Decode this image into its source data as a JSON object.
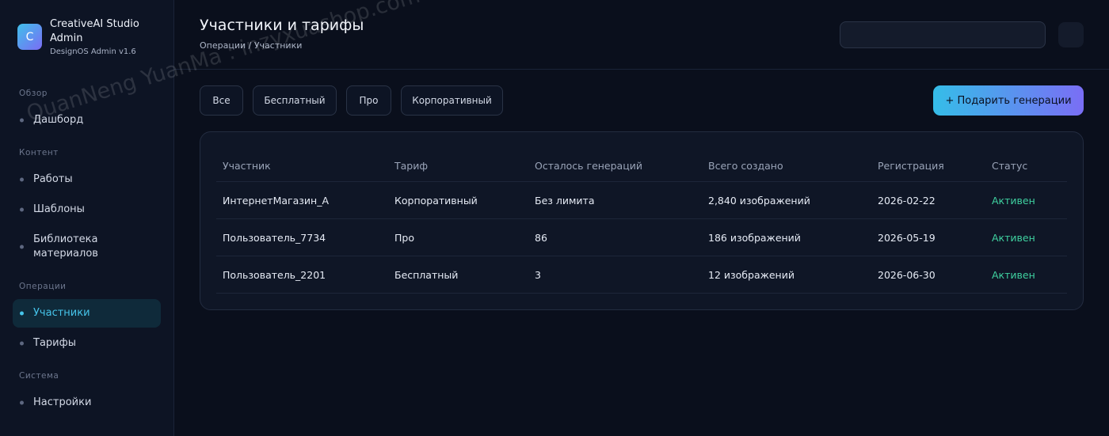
{
  "brand": {
    "logo_letter": "C",
    "title": "CreativeAI Studio Admin",
    "subtitle": "DesignOS Admin v1.6"
  },
  "sidebar": {
    "sections": [
      {
        "label": "Обзор"
      },
      {
        "label": "Контент"
      },
      {
        "label": "Операции"
      },
      {
        "label": "Система"
      }
    ],
    "items": [
      {
        "label": "Дашборд"
      },
      {
        "label": "Работы"
      },
      {
        "label": "Шаблоны"
      },
      {
        "label": "Библиотека материалов"
      },
      {
        "label": "Участники",
        "active": true
      },
      {
        "label": "Тарифы"
      },
      {
        "label": "Настройки"
      }
    ]
  },
  "header": {
    "title": "Участники и тарифы",
    "breadcrumb": "Операции / Участники",
    "search_value": ""
  },
  "filters": [
    "Все",
    "Бесплатный",
    "Про",
    "Корпоративный"
  ],
  "actions": {
    "gift_label": "+ Подарить генерации"
  },
  "table": {
    "columns": [
      "Участник",
      "Тариф",
      "Осталось генераций",
      "Всего создано",
      "Регистрация",
      "Статус"
    ],
    "rows": [
      [
        "ИнтернетМагазин_A",
        "Корпоративный",
        "Без лимита",
        "2,840 изображений",
        "2026-02-22",
        "Активен"
      ],
      [
        "Пользователь_7734",
        "Про",
        "86",
        "186 изображений",
        "2026-05-19",
        "Активен"
      ],
      [
        "Пользователь_2201",
        "Бесплатный",
        "3",
        "12 изображений",
        "2026-06-30",
        "Активен"
      ]
    ]
  },
  "watermark": "QuanNeng YuanMa : inzyxuashop.com",
  "colors": {
    "accent": "#46c4ea",
    "gradient_start": "#35bde8",
    "gradient_end": "#7a6ef5",
    "status_active": "#3fd1a0"
  }
}
